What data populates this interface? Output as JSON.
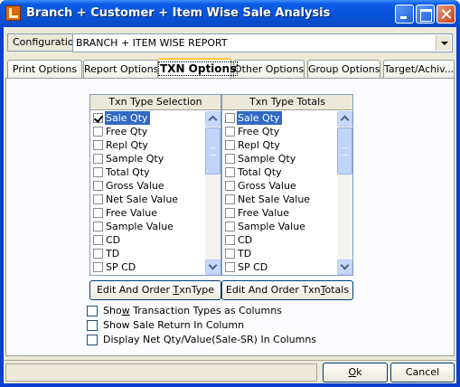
{
  "window": {
    "title": "Branch + Customer + Item Wise Sale Analysis",
    "controls": {
      "minimize": "minimize-icon",
      "maximize": "maximize-icon",
      "close": "close-icon"
    }
  },
  "config": {
    "label": "Configuration",
    "value": "BRANCH + ITEM WISE REPORT"
  },
  "tabs": [
    {
      "label": "Print Options",
      "active": false
    },
    {
      "label": "Report Options",
      "active": false
    },
    {
      "label": "TXN Options",
      "active": true
    },
    {
      "label": "Other Options",
      "active": false
    },
    {
      "label": "Group Options",
      "active": false
    },
    {
      "label": "Target/Achiv...",
      "active": false
    }
  ],
  "selection": {
    "header": "Txn Type Selection",
    "items": [
      "Sale Qty",
      "Free Qty",
      "Repl Qty",
      "Sample Qty",
      "Total Qty",
      "Gross Value",
      "Net Sale Value",
      "Free Value",
      "Sample Value",
      "CD",
      "TD",
      "SP CD"
    ],
    "checked": [
      true,
      false,
      false,
      false,
      false,
      false,
      false,
      false,
      false,
      false,
      false,
      false
    ],
    "selected_index": 0,
    "button": {
      "pre": "Edit And Order ",
      "accel": "T",
      "post": "xnType"
    }
  },
  "totals": {
    "header": "Txn Type Totals",
    "items": [
      "Sale Qty",
      "Free Qty",
      "Repl Qty",
      "Sample Qty",
      "Total Qty",
      "Gross Value",
      "Net Sale Value",
      "Free Value",
      "Sample Value",
      "CD",
      "TD",
      "SP CD"
    ],
    "checked": [
      false,
      false,
      false,
      false,
      false,
      false,
      false,
      false,
      false,
      false,
      false,
      false
    ],
    "selected_index": 0,
    "button": {
      "pre": "Edit And Order Txn",
      "accel": "T",
      "post": "otals"
    }
  },
  "options": [
    {
      "pre": "Sho",
      "accel": "w",
      "post": " Transaction Types as Columns",
      "checked": false
    },
    {
      "pre": "Show Sale Return In Column",
      "accel": "",
      "post": "",
      "checked": false
    },
    {
      "pre": "Display Net Qty/Value(Sale-SR) In Columns",
      "accel": "",
      "post": "",
      "checked": false
    }
  ],
  "footer": {
    "ok": {
      "accel": "O",
      "post": "k"
    },
    "cancel": {
      "pre": "Cancel"
    }
  }
}
